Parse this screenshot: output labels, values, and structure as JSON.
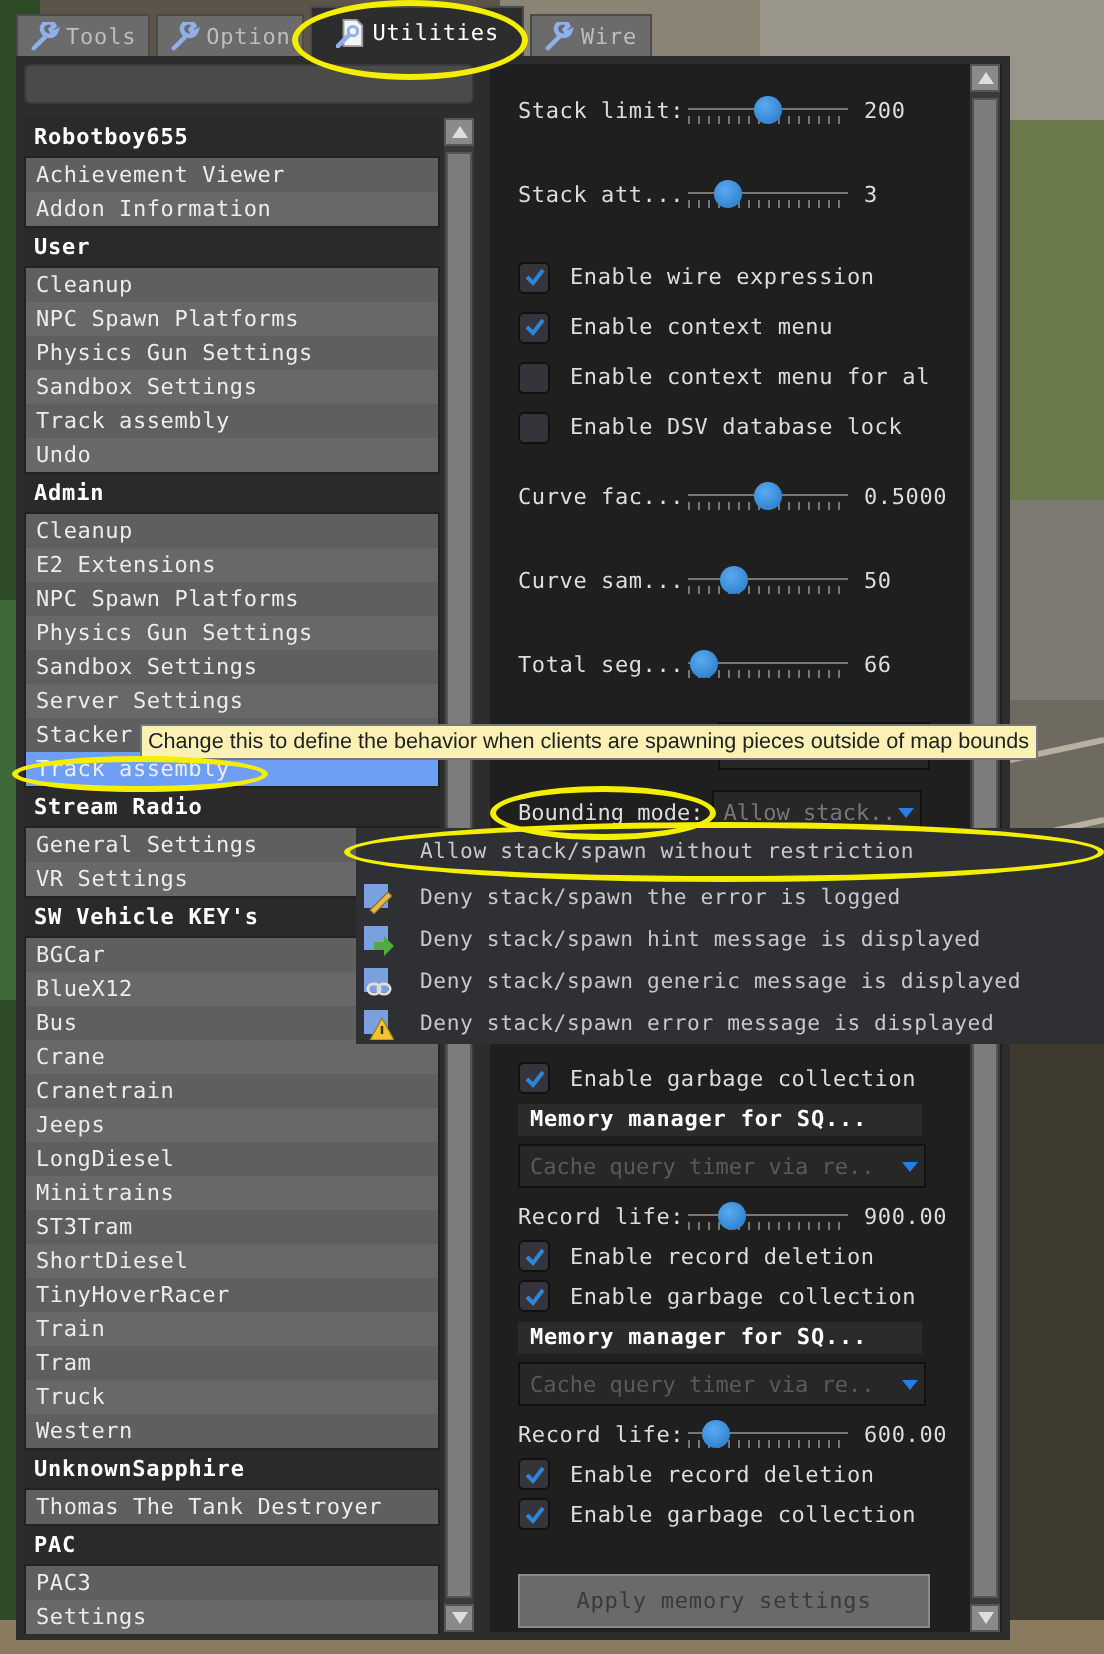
{
  "tabs": [
    {
      "label": "Tools",
      "selected": false
    },
    {
      "label": "Option",
      "selected": false
    },
    {
      "label": "Utilities",
      "selected": true
    },
    {
      "label": "Wire",
      "selected": false
    }
  ],
  "categories": [
    {
      "title": "Robotboy655",
      "items": [
        {
          "label": "Achievement Viewer",
          "selected": false
        },
        {
          "label": "Addon Information",
          "selected": false
        }
      ]
    },
    {
      "title": "User",
      "items": [
        {
          "label": "Cleanup",
          "selected": false
        },
        {
          "label": "NPC Spawn Platforms",
          "selected": false
        },
        {
          "label": "Physics Gun Settings",
          "selected": false
        },
        {
          "label": "Sandbox Settings",
          "selected": false
        },
        {
          "label": "Track assembly",
          "selected": false
        },
        {
          "label": "Undo",
          "selected": false
        }
      ]
    },
    {
      "title": "Admin",
      "items": [
        {
          "label": "Cleanup",
          "selected": false
        },
        {
          "label": "E2 Extensions",
          "selected": false
        },
        {
          "label": "NPC Spawn Platforms",
          "selected": false
        },
        {
          "label": "Physics Gun Settings",
          "selected": false
        },
        {
          "label": "Sandbox Settings",
          "selected": false
        },
        {
          "label": "Server Settings",
          "selected": false
        },
        {
          "label": "Stacker",
          "selected": false
        },
        {
          "label": "Track assembly",
          "selected": true
        }
      ]
    },
    {
      "title": "Stream Radio",
      "items": [
        {
          "label": "General Settings",
          "selected": false
        },
        {
          "label": "VR Settings",
          "selected": false
        }
      ]
    },
    {
      "title": "SW Vehicle KEY's",
      "items": [
        {
          "label": "BGCar",
          "selected": false
        },
        {
          "label": "BlueX12",
          "selected": false
        },
        {
          "label": "Bus",
          "selected": false
        },
        {
          "label": "Crane",
          "selected": false
        },
        {
          "label": "Cranetrain",
          "selected": false
        },
        {
          "label": "Jeeps",
          "selected": false
        },
        {
          "label": "LongDiesel",
          "selected": false
        },
        {
          "label": "Minitrains",
          "selected": false
        },
        {
          "label": "ST3Tram",
          "selected": false
        },
        {
          "label": "ShortDiesel",
          "selected": false
        },
        {
          "label": "TinyHoverRacer",
          "selected": false
        },
        {
          "label": "Train",
          "selected": false
        },
        {
          "label": "Tram",
          "selected": false
        },
        {
          "label": "Truck",
          "selected": false
        },
        {
          "label": "Western",
          "selected": false
        }
      ]
    },
    {
      "title": "UnknownSapphire",
      "items": [
        {
          "label": "Thomas The Tank Destroyer",
          "selected": false
        }
      ]
    },
    {
      "title": "PAC",
      "items": [
        {
          "label": "PAC3",
          "selected": false
        },
        {
          "label": "Settings",
          "selected": false
        }
      ]
    }
  ],
  "settings": [
    {
      "kind": "slider",
      "label": "Stack limit:",
      "value": "200",
      "level": 0.5
    },
    {
      "kind": "slider",
      "label": "Stack att...",
      "value": "3",
      "level": 0.2
    },
    {
      "kind": "checkbox",
      "label": "Enable wire expression",
      "checked": true
    },
    {
      "kind": "checkbox",
      "label": "Enable context menu",
      "checked": true
    },
    {
      "kind": "checkbox",
      "label": "Enable context menu for al",
      "checked": false
    },
    {
      "kind": "checkbox",
      "label": "Enable DSV database lock",
      "checked": false
    },
    {
      "kind": "slider",
      "label": "Curve fac...",
      "value": "0.5000",
      "level": 0.5
    },
    {
      "kind": "slider",
      "label": "Curve sam...",
      "value": "50",
      "level": 0.24
    },
    {
      "kind": "slider",
      "label": "Total seg...",
      "value": "66",
      "level": 0.02
    },
    {
      "kind": "blank_combo"
    },
    {
      "kind": "labeled_combo",
      "label": "Bounding mode:",
      "value": "Allow stack.."
    },
    {
      "kind": "checkbox",
      "label": "Enable garbage collection",
      "checked": true
    },
    {
      "kind": "header",
      "label": "Memory manager for SQ..."
    },
    {
      "kind": "combo",
      "value": "Cache query timer via re.."
    },
    {
      "kind": "slider",
      "label": "Record life:",
      "value": "900.00",
      "level": 0.22
    },
    {
      "kind": "checkbox",
      "label": "Enable record deletion",
      "checked": true
    },
    {
      "kind": "checkbox",
      "label": "Enable garbage collection",
      "checked": true
    },
    {
      "kind": "header",
      "label": "Memory manager for SQ..."
    },
    {
      "kind": "combo",
      "value": "Cache query timer via re.."
    },
    {
      "kind": "slider",
      "label": "Record life:",
      "value": "600.00",
      "level": 0.1
    },
    {
      "kind": "checkbox",
      "label": "Enable record deletion",
      "checked": true
    },
    {
      "kind": "checkbox",
      "label": "Enable garbage collection",
      "checked": true
    },
    {
      "kind": "button",
      "label": "Apply memory settings"
    }
  ],
  "tooltip": "Change this to define the behavior when clients are spawning pieces outside of map bounds",
  "dropdown": {
    "options": [
      {
        "label": "Allow stack/spawn without restriction"
      },
      {
        "label": "Deny stack/spawn the error is logged"
      },
      {
        "label": "Deny stack/spawn hint message is displayed"
      },
      {
        "label": "Deny stack/spawn generic message is displayed"
      },
      {
        "label": "Deny stack/spawn error message is displayed"
      }
    ]
  }
}
